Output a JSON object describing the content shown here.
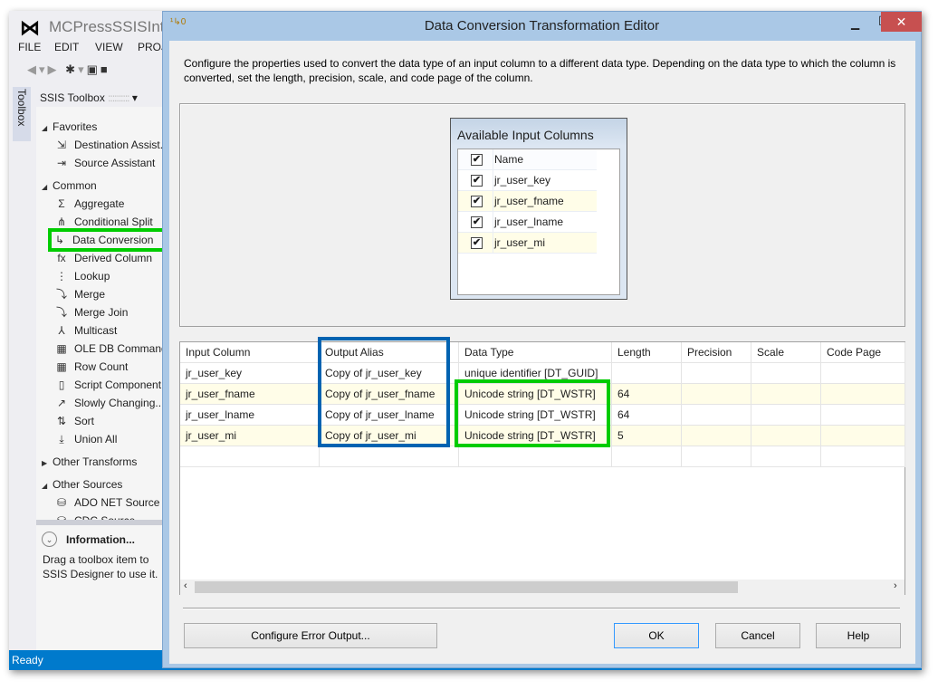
{
  "ide": {
    "title": "MCPressSSISIntro -",
    "menu": [
      "FILE",
      "EDIT",
      "VIEW",
      "PROJ"
    ],
    "toolbox_tab": "Toolbox",
    "toolbox_title": "SSIS Toolbox",
    "groups": [
      {
        "label": "Favorites",
        "expanded": true,
        "items": [
          {
            "label": "Destination Assist...",
            "icon": "destination-assistant-icon",
            "glyph": "⇲"
          },
          {
            "label": "Source Assistant",
            "icon": "source-assistant-icon",
            "glyph": "⇥"
          }
        ]
      },
      {
        "label": "Common",
        "expanded": true,
        "items": [
          {
            "label": "Aggregate",
            "icon": "aggregate-icon",
            "glyph": "Σ"
          },
          {
            "label": "Conditional Split",
            "icon": "conditional-split-icon",
            "glyph": "⋔"
          },
          {
            "label": "Data Conversion",
            "icon": "data-conversion-icon",
            "glyph": "↳",
            "highlighted": true
          },
          {
            "label": "Derived Column",
            "icon": "derived-column-icon",
            "glyph": "fx"
          },
          {
            "label": "Lookup",
            "icon": "lookup-icon",
            "glyph": "⋮"
          },
          {
            "label": "Merge",
            "icon": "merge-icon",
            "glyph": "⤵"
          },
          {
            "label": "Merge Join",
            "icon": "merge-join-icon",
            "glyph": "⤵"
          },
          {
            "label": "Multicast",
            "icon": "multicast-icon",
            "glyph": "⅄"
          },
          {
            "label": "OLE DB Command",
            "icon": "ole-db-command-icon",
            "glyph": "▦"
          },
          {
            "label": "Row Count",
            "icon": "row-count-icon",
            "glyph": "▦"
          },
          {
            "label": "Script Component",
            "icon": "script-component-icon",
            "glyph": "▯"
          },
          {
            "label": "Slowly Changing...",
            "icon": "slowly-changing-dimension-icon",
            "glyph": "↗"
          },
          {
            "label": "Sort",
            "icon": "sort-icon",
            "glyph": "⇅"
          },
          {
            "label": "Union All",
            "icon": "union-all-icon",
            "glyph": "⤓"
          }
        ]
      },
      {
        "label": "Other Transforms",
        "expanded": false,
        "items": []
      },
      {
        "label": "Other Sources",
        "expanded": true,
        "items": [
          {
            "label": "ADO NET Source",
            "icon": "ado-net-source-icon",
            "glyph": "⛁"
          },
          {
            "label": "CDC Source",
            "icon": "cdc-source-icon",
            "glyph": "⛁"
          }
        ]
      }
    ],
    "info_title": "Information...",
    "info_text": "Drag a toolbox item to SSIS Designer to use it.",
    "status": "Ready"
  },
  "dialog": {
    "title": "Data Conversion Transformation Editor",
    "description": "Configure the properties used to convert the data type of an input column to a different data type. Depending on the data type to which the column is converted, set the length, precision, scale, and code page of the column.",
    "available": {
      "title": "Available Input Columns",
      "header": "Name",
      "header_checked": true,
      "columns": [
        {
          "name": "jr_user_key",
          "checked": true
        },
        {
          "name": "jr_user_fname",
          "checked": true
        },
        {
          "name": "jr_user_lname",
          "checked": true
        },
        {
          "name": "jr_user_mi",
          "checked": true
        }
      ]
    },
    "grid": {
      "headers": [
        "Input Column",
        "Output Alias",
        "Data Type",
        "Length",
        "Precision",
        "Scale",
        "Code Page"
      ],
      "rows": [
        [
          "jr_user_key",
          "Copy of jr_user_key",
          "unique identifier [DT_GUID]",
          "",
          "",
          "",
          ""
        ],
        [
          "jr_user_fname",
          "Copy of jr_user_fname",
          "Unicode string [DT_WSTR]",
          "64",
          "",
          "",
          ""
        ],
        [
          "jr_user_lname",
          "Copy of jr_user_lname",
          "Unicode string [DT_WSTR]",
          "64",
          "",
          "",
          ""
        ],
        [
          "jr_user_mi",
          "Copy of jr_user_mi",
          "Unicode string [DT_WSTR]",
          "5",
          "",
          "",
          ""
        ]
      ]
    },
    "buttons": {
      "error_output": "Configure Error Output...",
      "ok": "OK",
      "cancel": "Cancel",
      "help": "Help"
    }
  },
  "colors": {
    "status_bar": "#007acc",
    "highlight_green": "#00cc00",
    "highlight_blue": "#0063b1",
    "alt_row": "#fffde8",
    "close": "#c75050"
  }
}
